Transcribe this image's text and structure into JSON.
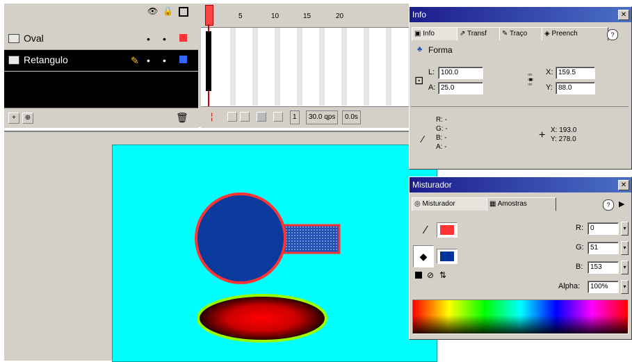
{
  "timeline": {
    "layers": [
      {
        "name": "Oval",
        "color": "#ff3333",
        "selected": false
      },
      {
        "name": "Retangulo",
        "color": "#3366ff",
        "selected": true
      }
    ],
    "ruler_numbers": [
      "1",
      "5",
      "10",
      "15",
      "20"
    ],
    "current_frame": "1",
    "frame_rate": "30.0 qps",
    "elapsed": "0.0s"
  },
  "info_panel": {
    "title": "Info",
    "tabs": [
      "Info",
      "Transf",
      "Traço",
      "Preench"
    ],
    "section": "Forma",
    "L": {
      "label": "L:",
      "value": "100.0"
    },
    "A": {
      "label": "A:",
      "value": "25.0"
    },
    "X": {
      "label": "X:",
      "value": "159.5"
    },
    "Y": {
      "label": "Y:",
      "value": "88.0"
    },
    "rgba": [
      "R: -",
      "G: -",
      "B: -",
      "A: -"
    ],
    "cursor_x": "X: 193.0",
    "cursor_y": "Y: 278.0"
  },
  "mixer_panel": {
    "title": "Misturador",
    "tabs": [
      "Misturador",
      "Amostras"
    ],
    "stroke_color": "#ff3333",
    "fill_color": "#003399",
    "R": {
      "label": "R:",
      "value": "0"
    },
    "G": {
      "label": "G:",
      "value": "51"
    },
    "B": {
      "label": "B:",
      "value": "153"
    },
    "alpha": {
      "label": "Alpha:",
      "value": "100%"
    }
  },
  "colors": {
    "stage_bg": "#00ffff",
    "circle_fill": "#0a3a9c",
    "stroke_red": "#ff3333",
    "oval_stroke": "#99ff00"
  }
}
